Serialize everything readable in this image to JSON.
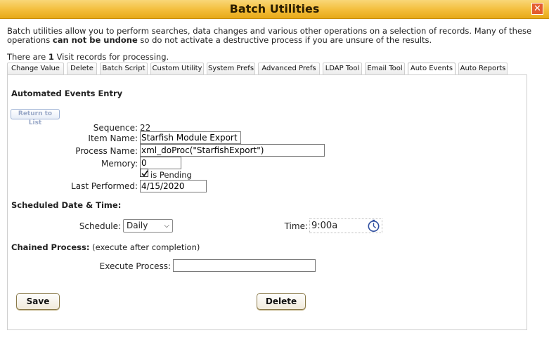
{
  "window": {
    "title": "Batch Utilities",
    "close_symbol": "✕"
  },
  "intro": {
    "part1": "Batch utilities allow you to perform searches, data changes and various other operations on a selection of records. Many of these operations ",
    "bold": "can not be undone",
    "part2": " so do not activate a destructive process if you are unsure of the results."
  },
  "count": {
    "prefix": "There are ",
    "number": "1",
    "suffix": " Visit records for processing."
  },
  "tabs": [
    {
      "label": "Change Value"
    },
    {
      "label": "Delete"
    },
    {
      "label": "Batch Script"
    },
    {
      "label": "Custom Utility"
    },
    {
      "label": "System Prefs"
    },
    {
      "label": "Advanced Prefs"
    },
    {
      "label": "LDAP Tool"
    },
    {
      "label": "Email Tool"
    },
    {
      "label": "Auto Events",
      "active": true
    },
    {
      "label": "Auto Reports"
    }
  ],
  "form": {
    "heading": "Automated Events Entry",
    "return_button": "Return to List",
    "sequence_label": "Sequence:",
    "sequence_value": "22",
    "item_name_label": "Item Name:",
    "item_name_value": "Starfish Module Export",
    "process_name_label": "Process Name:",
    "process_name_value": "xml_doProc(\"StarfishExport\")",
    "memory_label": "Memory:",
    "memory_value": "0",
    "is_pending_label": "is Pending",
    "is_pending_checked": true,
    "last_performed_label": "Last Performed:",
    "last_performed_value": "4/15/2020",
    "schedule_heading": "Scheduled Date & Time:",
    "schedule_label": "Schedule:",
    "schedule_value": "Daily",
    "time_label": "Time:",
    "time_value": "9:00a",
    "chained_heading": "Chained Process:",
    "chained_note": "(execute after completion)",
    "execute_label": "Execute Process:",
    "execute_value": "",
    "save_button": "Save",
    "delete_button": "Delete"
  },
  "colors": {
    "titlebar": "#f3bd3a",
    "close": "#e35d2f",
    "clock_icon": "#2f4fa0"
  },
  "icons": {
    "close": "close-icon",
    "check": "checkmark-icon",
    "clock": "clock-icon",
    "select": "chevron-down-icon"
  }
}
